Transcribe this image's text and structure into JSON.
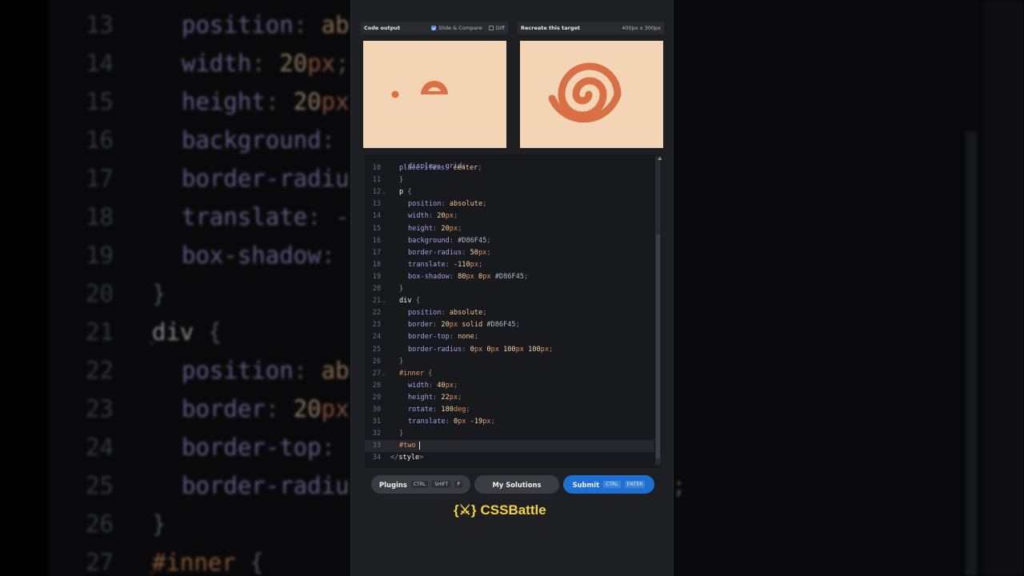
{
  "background_code": {
    "lines": [
      {
        "num": "13",
        "parts": [
          [
            "prop",
            "position"
          ],
          [
            "punc",
            ": "
          ],
          [
            "val",
            "ab"
          ]
        ],
        "indent": 1
      },
      {
        "num": "14",
        "parts": [
          [
            "prop",
            "width"
          ],
          [
            "punc",
            ": "
          ],
          [
            "num",
            "20"
          ],
          [
            "unit",
            "px"
          ],
          [
            "punc",
            ";"
          ]
        ],
        "indent": 1
      },
      {
        "num": "15",
        "parts": [
          [
            "prop",
            "height"
          ],
          [
            "punc",
            ": "
          ],
          [
            "num",
            "20"
          ],
          [
            "unit",
            "px"
          ]
        ],
        "indent": 1
      },
      {
        "num": "16",
        "parts": [
          [
            "prop",
            "background"
          ],
          [
            "punc",
            ":"
          ]
        ],
        "indent": 1
      },
      {
        "num": "17",
        "parts": [
          [
            "prop",
            "border-radiu"
          ]
        ],
        "indent": 1
      },
      {
        "num": "18",
        "parts": [
          [
            "prop",
            "translate"
          ],
          [
            "punc",
            ": -"
          ]
        ],
        "indent": 1
      },
      {
        "num": "19",
        "parts": [
          [
            "prop",
            "box-shadow"
          ],
          [
            "punc",
            ":"
          ]
        ],
        "indent": 1
      },
      {
        "num": "20",
        "parts": [
          [
            "punc",
            "}"
          ]
        ],
        "indent": 0
      },
      {
        "num": "21",
        "parts": [
          [
            "sel",
            "div "
          ],
          [
            "punc",
            "{"
          ]
        ],
        "indent": 0,
        "fold": "⌄"
      },
      {
        "num": "22",
        "parts": [
          [
            "prop",
            "position"
          ],
          [
            "punc",
            ": "
          ],
          [
            "val",
            "ab"
          ]
        ],
        "indent": 1
      },
      {
        "num": "23",
        "parts": [
          [
            "prop",
            "border"
          ],
          [
            "punc",
            ": "
          ],
          [
            "num",
            "20"
          ],
          [
            "unit",
            "px"
          ]
        ],
        "indent": 1
      },
      {
        "num": "24",
        "parts": [
          [
            "prop",
            "border-top"
          ],
          [
            "punc",
            ":"
          ]
        ],
        "indent": 1
      },
      {
        "num": "25",
        "parts": [
          [
            "prop",
            "border-radiu"
          ]
        ],
        "indent": 1
      },
      {
        "num": "26",
        "parts": [
          [
            "punc",
            "}"
          ]
        ],
        "indent": 0
      },
      {
        "num": "27",
        "parts": [
          [
            "id",
            "#inner "
          ],
          [
            "punc",
            "{"
          ]
        ],
        "indent": 0,
        "fold": "⌄"
      }
    ],
    "right_fragment": ";"
  },
  "output_pane": {
    "title": "Code output",
    "slide_compare_label": "Slide & Compare",
    "slide_compare_checked": true,
    "diff_label": "Diff",
    "diff_checked": false
  },
  "target_pane": {
    "title": "Recreate this target",
    "size": "400px x 300px"
  },
  "canvas_bg": "#F3D5B5",
  "shape_color": "#D86F45",
  "editor": {
    "top_partial": "display: grid;",
    "lines": [
      {
        "num": "10",
        "parts": [
          [
            "prop",
            "place-items"
          ],
          [
            "punc",
            ": "
          ],
          [
            "val",
            "center"
          ],
          [
            "punc",
            ";"
          ]
        ],
        "indent": 1
      },
      {
        "num": "11",
        "parts": [
          [
            "punc",
            "}"
          ]
        ],
        "indent": 1
      },
      {
        "num": "12",
        "fold": "⌄",
        "parts": [
          [
            "sel",
            "p "
          ],
          [
            "punc",
            "{"
          ]
        ],
        "indent": 1
      },
      {
        "num": "13",
        "parts": [
          [
            "prop",
            "position"
          ],
          [
            "punc",
            ": "
          ],
          [
            "val",
            "absolute"
          ],
          [
            "punc",
            ";"
          ]
        ],
        "indent": 2
      },
      {
        "num": "14",
        "parts": [
          [
            "prop",
            "width"
          ],
          [
            "punc",
            ": "
          ],
          [
            "num",
            "20"
          ],
          [
            "unit",
            "px"
          ],
          [
            "punc",
            ";"
          ]
        ],
        "indent": 2
      },
      {
        "num": "15",
        "parts": [
          [
            "prop",
            "height"
          ],
          [
            "punc",
            ": "
          ],
          [
            "num",
            "20"
          ],
          [
            "unit",
            "px"
          ],
          [
            "punc",
            ";"
          ]
        ],
        "indent": 2
      },
      {
        "num": "16",
        "parts": [
          [
            "prop",
            "background"
          ],
          [
            "punc",
            ": "
          ],
          [
            "hash",
            "#D86F45"
          ],
          [
            "punc",
            ";"
          ]
        ],
        "indent": 2
      },
      {
        "num": "17",
        "parts": [
          [
            "prop",
            "border-radius"
          ],
          [
            "punc",
            ": "
          ],
          [
            "num",
            "50"
          ],
          [
            "unit",
            "px"
          ],
          [
            "punc",
            ";"
          ]
        ],
        "indent": 2
      },
      {
        "num": "18",
        "parts": [
          [
            "prop",
            "translate"
          ],
          [
            "punc",
            ": "
          ],
          [
            "num",
            "-110"
          ],
          [
            "unit",
            "px"
          ],
          [
            "punc",
            ";"
          ]
        ],
        "indent": 2
      },
      {
        "num": "19",
        "parts": [
          [
            "prop",
            "box-shadow"
          ],
          [
            "punc",
            ": "
          ],
          [
            "num",
            "80"
          ],
          [
            "unit",
            "px "
          ],
          [
            "num",
            "0"
          ],
          [
            "unit",
            "px "
          ],
          [
            "hash",
            "#D86F45"
          ],
          [
            "punc",
            ";"
          ]
        ],
        "indent": 2
      },
      {
        "num": "20",
        "parts": [
          [
            "punc",
            "}"
          ]
        ],
        "indent": 1
      },
      {
        "num": "21",
        "fold": "⌄",
        "parts": [
          [
            "sel",
            "div "
          ],
          [
            "punc",
            "{"
          ]
        ],
        "indent": 1
      },
      {
        "num": "22",
        "parts": [
          [
            "prop",
            "position"
          ],
          [
            "punc",
            ": "
          ],
          [
            "val",
            "absolute"
          ],
          [
            "punc",
            ";"
          ]
        ],
        "indent": 2
      },
      {
        "num": "23",
        "parts": [
          [
            "prop",
            "border"
          ],
          [
            "punc",
            ": "
          ],
          [
            "num",
            "20"
          ],
          [
            "unit",
            "px "
          ],
          [
            "val",
            "solid "
          ],
          [
            "hash",
            "#D86F45"
          ],
          [
            "punc",
            ";"
          ]
        ],
        "indent": 2
      },
      {
        "num": "24",
        "parts": [
          [
            "prop",
            "border-top"
          ],
          [
            "punc",
            ": "
          ],
          [
            "val",
            "none"
          ],
          [
            "punc",
            ";"
          ]
        ],
        "indent": 2
      },
      {
        "num": "25",
        "parts": [
          [
            "prop",
            "border-radius"
          ],
          [
            "punc",
            ": "
          ],
          [
            "num",
            "0"
          ],
          [
            "unit",
            "px "
          ],
          [
            "num",
            "0"
          ],
          [
            "unit",
            "px "
          ],
          [
            "num",
            "100"
          ],
          [
            "unit",
            "px "
          ],
          [
            "num",
            "100"
          ],
          [
            "unit",
            "px"
          ],
          [
            "punc",
            ";"
          ]
        ],
        "indent": 2
      },
      {
        "num": "26",
        "parts": [
          [
            "punc",
            "}"
          ]
        ],
        "indent": 1
      },
      {
        "num": "27",
        "fold": "⌄",
        "parts": [
          [
            "id",
            "#inner "
          ],
          [
            "punc",
            "{"
          ]
        ],
        "indent": 1
      },
      {
        "num": "28",
        "parts": [
          [
            "prop",
            "width"
          ],
          [
            "punc",
            ": "
          ],
          [
            "num",
            "40"
          ],
          [
            "unit",
            "px"
          ],
          [
            "punc",
            ";"
          ]
        ],
        "indent": 2
      },
      {
        "num": "29",
        "parts": [
          [
            "prop",
            "height"
          ],
          [
            "punc",
            ": "
          ],
          [
            "num",
            "22"
          ],
          [
            "unit",
            "px"
          ],
          [
            "punc",
            ";"
          ]
        ],
        "indent": 2
      },
      {
        "num": "30",
        "parts": [
          [
            "prop",
            "rotate"
          ],
          [
            "punc",
            ": "
          ],
          [
            "num",
            "180"
          ],
          [
            "unit",
            "deg"
          ],
          [
            "punc",
            ";"
          ]
        ],
        "indent": 2
      },
      {
        "num": "31",
        "parts": [
          [
            "prop",
            "translate"
          ],
          [
            "punc",
            ": "
          ],
          [
            "num",
            "0"
          ],
          [
            "unit",
            "px "
          ],
          [
            "num",
            "-19"
          ],
          [
            "unit",
            "px"
          ],
          [
            "punc",
            ";"
          ]
        ],
        "indent": 2
      },
      {
        "num": "32",
        "parts": [
          [
            "punc",
            "}"
          ]
        ],
        "indent": 1
      },
      {
        "num": "33",
        "parts": [
          [
            "id",
            "#two"
          ]
        ],
        "indent": 1,
        "active": true,
        "cursor": true
      },
      {
        "num": "34",
        "parts": [
          [
            "punc",
            "</"
          ],
          [
            "tag",
            "style"
          ],
          [
            "punc",
            ">"
          ]
        ],
        "indent": 0
      }
    ]
  },
  "buttons": {
    "plugins": {
      "label": "Plugins",
      "keys": [
        "CTRL",
        "SHIFT",
        "P"
      ]
    },
    "solutions": {
      "label": "My Solutions"
    },
    "submit": {
      "label": "Submit",
      "keys": [
        "CTRL",
        "ENTER"
      ]
    }
  },
  "brand": {
    "logo_text": "{⚔}",
    "name": "CSSBattle"
  }
}
